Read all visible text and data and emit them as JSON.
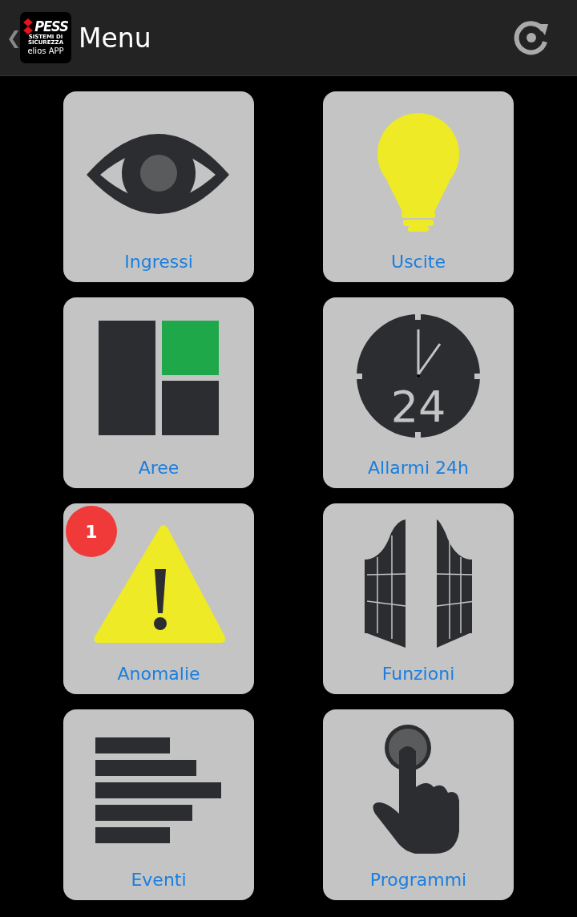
{
  "header": {
    "back": "❮",
    "logo": {
      "brand": "PESS",
      "tagline": "SISTEMI DI SICUREZZA",
      "app": "elios APP"
    },
    "title": "Menu"
  },
  "tiles": [
    {
      "label": "Ingressi",
      "kind": "eye"
    },
    {
      "label": "Uscite",
      "kind": "bulb"
    },
    {
      "label": "Aree",
      "kind": "areas"
    },
    {
      "label": "Allarmi 24h",
      "kind": "clock",
      "icon_text": "24"
    },
    {
      "label": "Anomalie",
      "kind": "warning",
      "badge": "1"
    },
    {
      "label": "Funzioni",
      "kind": "gate"
    },
    {
      "label": "Eventi",
      "kind": "list"
    },
    {
      "label": "Programmi",
      "kind": "hand"
    }
  ]
}
